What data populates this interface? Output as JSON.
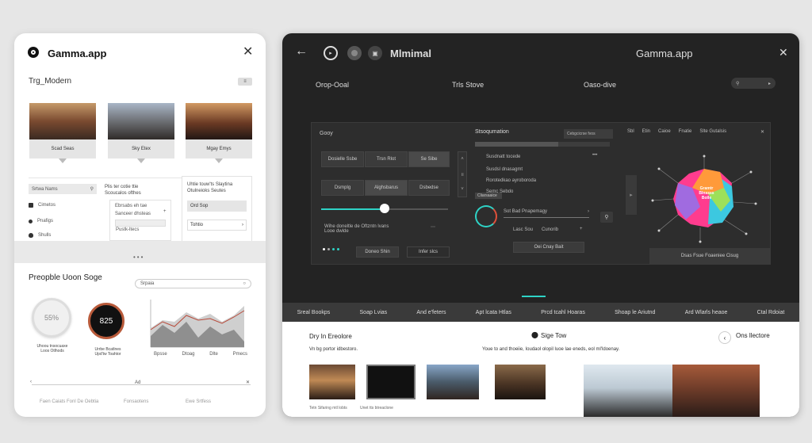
{
  "left_panel": {
    "app_title": "Gamma.app",
    "subtitle": "Trg_Modern",
    "thumbs": [
      {
        "caption": "Scad Seas"
      },
      {
        "caption": "Sky Etex"
      },
      {
        "caption": "Mgay Emys"
      }
    ],
    "sidebar_select": "Srtwa Nams",
    "sidebar_items": [
      "Cimetos",
      "Pnafigs",
      "Shulls"
    ],
    "middle_text": "Plis ter cotie ttie\nScoucalos ofthes",
    "middle_list": [
      "Ebrsabs eh tae",
      "Sanceer dhsteas",
      "Pustk-ltecs"
    ],
    "right_text": "Uhtie touw'ts Slaytina\nOtulneioks Seutes",
    "right_btn1": "Ord Sop",
    "right_btn2": "Tohtio",
    "section_title": "Preopble Uoon Soge",
    "search_placeholder": "Srpaia",
    "gauge1_value": "55%",
    "gauge2_value": "825",
    "gauge1_caption": "Uhoou tnsocuaxe\nLoos Otlhods",
    "gauge2_caption": "Urrbe Bcatlnes\nUpd'tw Toahtor",
    "chart_xlabels": [
      "Bpsse",
      "Dtoag",
      "Dlte",
      "Pmecs"
    ],
    "slider_mid": "Ad",
    "footer": [
      "Faen Caiats Fonl De Oebtia",
      "Fonsaotens",
      "Ewe Srtfess"
    ]
  },
  "right_panel": {
    "title": "Mlmimal",
    "app_title": "Gamma.app",
    "header_tabs": [
      "Orop-Ooal",
      "Trls Stove",
      "Oaso-dive"
    ],
    "modal_title": "Gooy",
    "grid_buttons": [
      "Dosielle Ssbe",
      "Trsn Rlot",
      "Se Sibe",
      "Dsmplg",
      "Alghsbarus",
      "Dsbedse"
    ],
    "mid_title": "Stsoqumation",
    "mid_select": "Cebgcicrse fvos",
    "mid_rows": [
      "Susdnatt tocede",
      "Susdsl dnasagmt",
      "Rorotedkao ayroboroda",
      "Semc Sebdo"
    ],
    "mid_chip": "Cliarsaaice",
    "status_text": "Sot Bad Pnapemagy",
    "status_sub1": "Lasc Sou",
    "status_sub2": "Cunorib",
    "status_btn": "Oei Cnay Bait",
    "left_note": "Wihe doneltle de Oftzntn lvans\nLooe dwlde",
    "bottom_btn1": "Doneo Shin",
    "bottom_btn2": "Infer slcs",
    "right_mini_tabs": [
      "Sbl",
      "Etin",
      "Caioe",
      "Fnatie",
      "Slte Gutalsis"
    ],
    "right_caption": "Dsas Fsue Foaeniee Cisug",
    "mind_labels": [
      "Gramtr\nBlnssss\nBolle"
    ],
    "nav_tabs": [
      "Sreal Bookps",
      "Soap Lvias",
      "And e'feters",
      "Apt lcata Htlas",
      "Prcd tcahl Hoaras",
      "Shoap le Ariutnd",
      "Ard Wlarls heaoe",
      "Ctal Rdoiat"
    ],
    "bottom_left_title": "Dry In Ereolore",
    "bottom_left_sub": "Vn bg portor idbestoro.",
    "bottom_mid_title": "Sige Tow",
    "bottom_mid_sub": "Youe to and thoeiie, Ioudaol olopil luoe lae eneds, eol ml'ldoenay.",
    "bottom_right_title": "Ons llectore",
    "photo_captions": [
      "Tetn Sifaring mtl lobts",
      "Unet tts btreaclone"
    ]
  },
  "colors": {
    "accent_teal": "#2ed3c6",
    "mind_pink": "#ff3c8e",
    "mind_orange": "#ff9a3a"
  }
}
